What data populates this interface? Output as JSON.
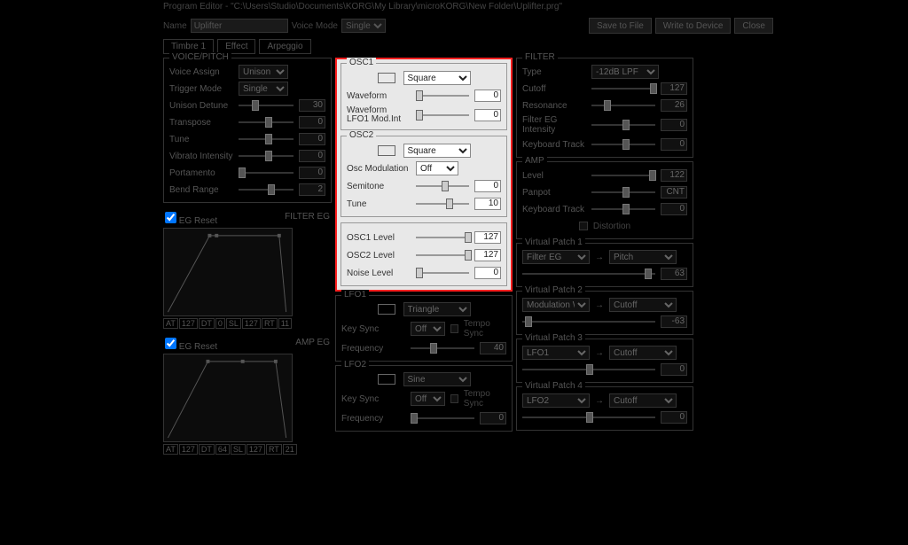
{
  "title": "Program Editor - \"C:\\Users\\Studio\\Documents\\KORG\\My Library\\microKORG\\New Folder\\Uplifter.prg\"",
  "header": {
    "name_label": "Name",
    "name_value": "Uplifter",
    "voice_mode_label": "Voice Mode",
    "voice_mode_value": "Single",
    "save_to_file": "Save to File",
    "write_to_device": "Write to Device",
    "close": "Close"
  },
  "tabs": [
    "Timbre 1",
    "Effect",
    "Arpeggio"
  ],
  "voicepitch": {
    "title": "VOICE/PITCH",
    "voice_assign_label": "Voice Assign",
    "voice_assign": "Unison",
    "trigger_mode_label": "Trigger Mode",
    "trigger_mode": "Single",
    "unison_detune_label": "Unison Detune",
    "unison_detune": "30",
    "transpose_label": "Transpose",
    "transpose": "0",
    "tune_label": "Tune",
    "tune": "0",
    "vibrato_label": "Vibrato Intensity",
    "vibrato": "0",
    "portamento_label": "Portamento",
    "portamento": "0",
    "bendrange_label": "Bend Range",
    "bendrange": "2"
  },
  "eg1": {
    "label_reset": "EG Reset",
    "label": "FILTER EG",
    "at": "AT",
    "atv": "127",
    "dt": "DT",
    "dtv": "0",
    "sl": "SL",
    "slv": "127",
    "rt": "RT",
    "rtv": "11"
  },
  "eg2": {
    "label_reset": "EG Reset",
    "label": "AMP EG",
    "at": "AT",
    "atv": "127",
    "dt": "DT",
    "dtv": "64",
    "sl": "SL",
    "slv": "127",
    "rt": "RT",
    "rtv": "21"
  },
  "osc1": {
    "title": "OSC1",
    "waveform_select": "Square",
    "waveform_label": "Waveform",
    "waveform": "0",
    "lfo1_label": "Waveform LFO1 Mod.Int",
    "lfo1": "0"
  },
  "osc2": {
    "title": "OSC2",
    "waveform_select": "Square",
    "oscmod_label": "Osc Modulation",
    "oscmod": "Off",
    "semitone_label": "Semitone",
    "semitone": "0",
    "tune_label": "Tune",
    "tune": "10"
  },
  "levels": {
    "osc1_label": "OSC1 Level",
    "osc1": "127",
    "osc2_label": "OSC2 Level",
    "osc2": "127",
    "noise_label": "Noise Level",
    "noise": "0"
  },
  "lfo1": {
    "title": "LFO1",
    "wave": "Triangle",
    "keysync_label": "Key Sync",
    "keysync": "Off",
    "temposync": "Tempo Sync",
    "freq_label": "Frequency",
    "freq": "40"
  },
  "lfo2": {
    "title": "LFO2",
    "wave": "Sine",
    "keysync_label": "Key Sync",
    "keysync": "Off",
    "temposync": "Tempo Sync",
    "freq_label": "Frequency",
    "freq": "0"
  },
  "filter": {
    "title": "FILTER",
    "type_label": "Type",
    "type": "-12dB LPF",
    "cutoff_label": "Cutoff",
    "cutoff": "127",
    "resonance_label": "Resonance",
    "resonance": "26",
    "eg_label": "Filter EG Intensity",
    "eg": "0",
    "kbd_label": "Keyboard Track",
    "kbd": "0"
  },
  "amp": {
    "title": "AMP",
    "level_label": "Level",
    "level": "122",
    "panpot_label": "Panpot",
    "panpot": "CNT",
    "kbd_label": "Keyboard Track",
    "kbd": "0",
    "distortion": "Distortion"
  },
  "vp": {
    "t1": "Virtual Patch 1",
    "s1a": "Filter EG",
    "s1b": "Pitch",
    "v1": "63",
    "t2": "Virtual Patch 2",
    "s2a": "Modulation Wheel",
    "s2b": "Cutoff",
    "v2": "-63",
    "t3": "Virtual Patch 3",
    "s3a": "LFO1",
    "s3b": "Cutoff",
    "v3": "0",
    "t4": "Virtual Patch 4",
    "s4a": "LFO2",
    "s4b": "Cutoff",
    "v4": "0"
  }
}
